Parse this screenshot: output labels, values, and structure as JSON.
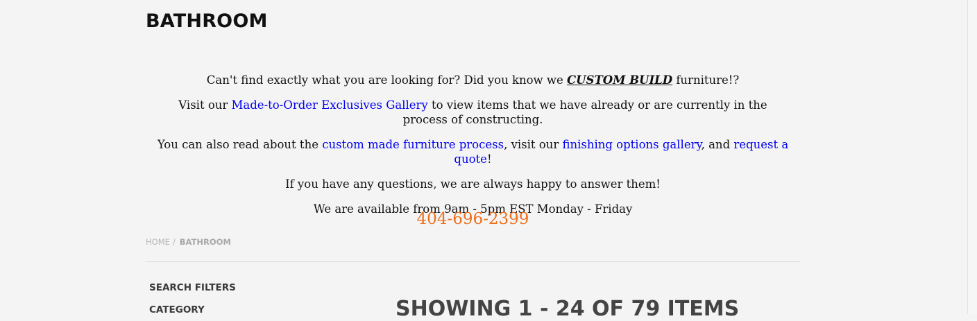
{
  "page": {
    "title": "BATHROOM"
  },
  "promo": {
    "line1_prefix": "Can't find exactly what you are looking for? Did you know we ",
    "line1_emphasis": "CUSTOM BUILD",
    "line1_suffix": " furniture!?",
    "line2_prefix": "Visit our ",
    "line2_link": "Made-to-Order Exclusives Gallery",
    "line2_suffix": " to view items that we have already or are currently in the process of constructing.",
    "line3_prefix": "You can also read about the ",
    "line3_link1": "custom made furniture process",
    "line3_mid1": ", visit our ",
    "line3_link2": "finishing options gallery",
    "line3_mid2": ", and ",
    "line3_link3": "request a quote",
    "line3_suffix": "!",
    "line4": "If you have any questions, we are always happy to answer them!",
    "line5": "We are available from 9am - 5pm EST Monday - Friday",
    "phone": "404-696-2399"
  },
  "breadcrumb": {
    "home": "HOME",
    "separator": "/",
    "current": "BATHROOM"
  },
  "filters": {
    "title": "SEARCH FILTERS",
    "category_title": "CATEGORY"
  },
  "results": {
    "heading": "SHOWING 1 - 24 OF 79 ITEMS"
  },
  "colors": {
    "background": "#f4f4f4",
    "link": "#0000ee",
    "phone": "#ef6f1c",
    "breadcrumb": "#b5b5b5"
  }
}
